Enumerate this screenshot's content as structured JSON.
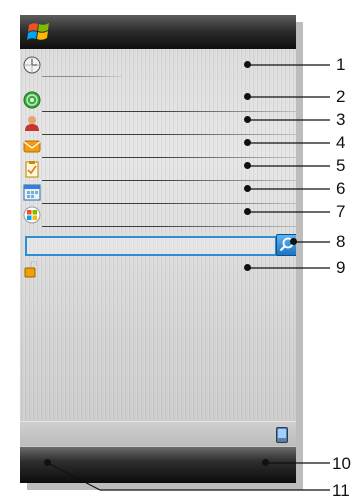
{
  "callouts": {
    "c1": "1",
    "c2": "2",
    "c3": "3",
    "c4": "4",
    "c5": "5",
    "c6": "6",
    "c7": "7",
    "c8": "8",
    "c9": "9",
    "c10": "10",
    "c11": "11"
  },
  "rows": [
    {
      "icon": "clock-icon"
    },
    {
      "icon": "wireless-icon"
    },
    {
      "icon": "contact-icon"
    },
    {
      "icon": "envelope-icon"
    },
    {
      "icon": "tasks-icon"
    },
    {
      "icon": "calendar-icon"
    },
    {
      "icon": "windows-logo-icon"
    },
    {
      "icon": "search-icon"
    },
    {
      "icon": "padlock-icon"
    }
  ],
  "colors": {
    "accent_blue": "#2b8fd6",
    "titlebar": "#1a1a1a",
    "callout_line": "#111111"
  }
}
